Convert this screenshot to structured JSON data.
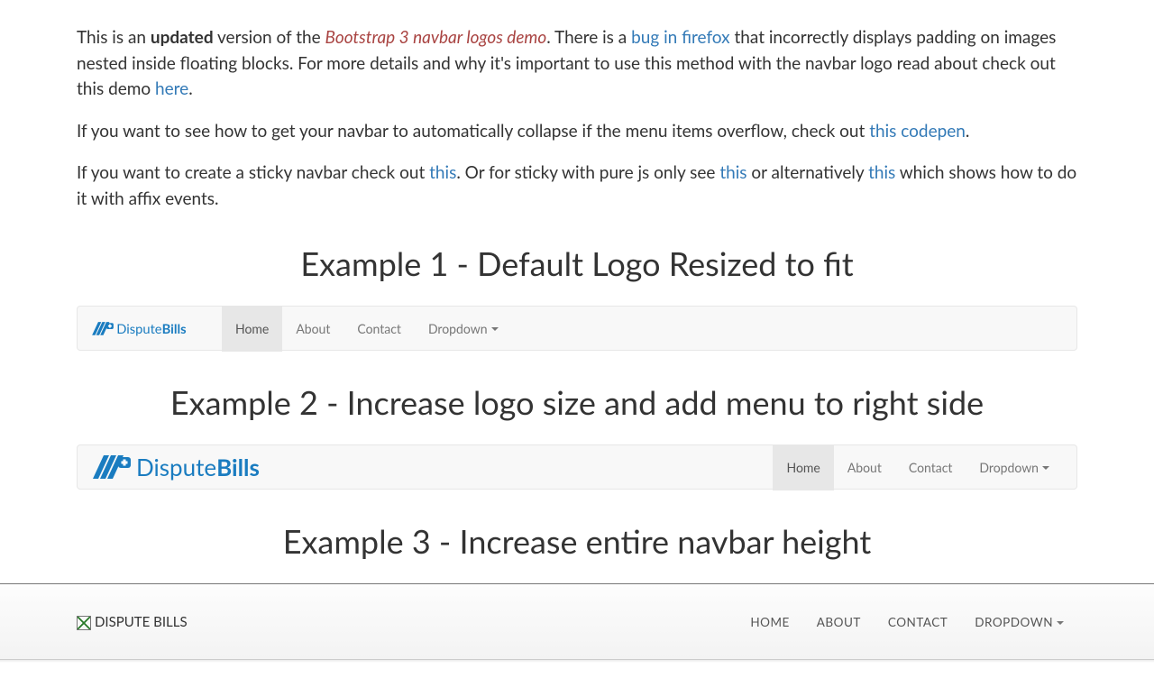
{
  "intro": {
    "p1_a": "This is an ",
    "p1_strong": "updated",
    "p1_b": " version of the ",
    "p1_em": "Bootstrap 3 navbar logos demo",
    "p1_c": ". There is a ",
    "p1_link1": "bug in firefox",
    "p1_d": " that incorrectly displays padding on images nested inside floating blocks. For more details and why it's important to use this method with the navbar logo read about check out this demo ",
    "p1_link2": "here",
    "p1_e": ".",
    "p2_a": "If you want to see how to get your navbar to automatically collapse if the menu items overflow, check out ",
    "p2_link": "this codepen",
    "p2_b": ".",
    "p3_a": "If you want to create a sticky navbar check out ",
    "p3_link1": "this",
    "p3_b": ". Or for sticky with pure js only see ",
    "p3_link2": "this",
    "p3_c": " or alternatively ",
    "p3_link3": "this",
    "p3_d": " which shows how to do it with affix events."
  },
  "headings": {
    "ex1": "Example 1 - Default Logo Resized to fit",
    "ex2": "Example 2 - Increase logo size and add menu to right side",
    "ex3": "Example 3 - Increase entire navbar height"
  },
  "nav": {
    "home": "Home",
    "about": "About",
    "contact": "Contact",
    "dropdown": "Dropdown"
  },
  "nav3": {
    "home": "HOME",
    "about": "ABOUT",
    "contact": "CONTACT",
    "dropdown": "DROPDOWN"
  },
  "brand_alt": "DISPUTE BILLS"
}
